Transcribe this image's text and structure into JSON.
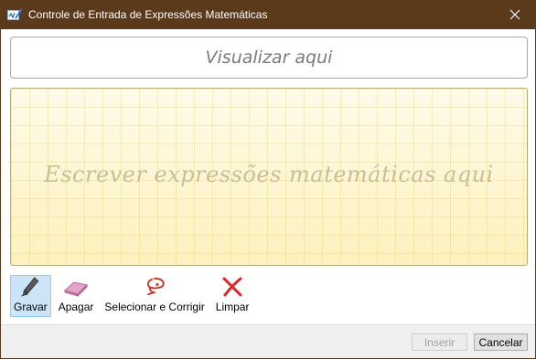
{
  "window": {
    "title": "Controle de Entrada de Expressões Matemáticas",
    "app_icon": "math-input-icon",
    "close_icon": "close-icon"
  },
  "preview": {
    "placeholder": "Visualizar aqui"
  },
  "canvas": {
    "hint": "Escrever expressões matemáticas aqui"
  },
  "toolbar": {
    "items": [
      {
        "label": "Gravar",
        "icon": "pen-icon",
        "active": true
      },
      {
        "label": "Apagar",
        "icon": "eraser-icon",
        "active": false
      },
      {
        "label": "Selecionar e Corrigir",
        "icon": "lasso-icon",
        "active": false
      },
      {
        "label": "Limpar",
        "icon": "clear-x-icon",
        "active": false
      }
    ]
  },
  "footer": {
    "insert_label": "Inserir",
    "insert_enabled": false,
    "cancel_label": "Cancelar"
  },
  "colors": {
    "titlebar": "#5b3a1c",
    "canvas": "#fdf3c4",
    "selected_tool": "#cce4f7",
    "clear_red": "#d9262b"
  }
}
